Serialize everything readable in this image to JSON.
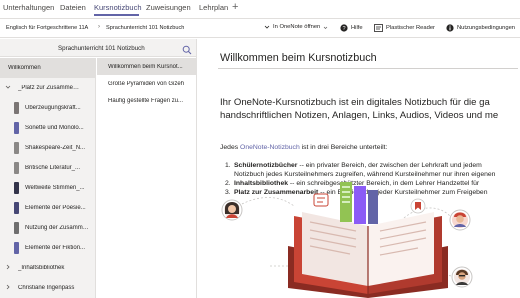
{
  "tabs": {
    "items": [
      "Unterhaltungen",
      "Dateien",
      "Kursnotizbuch",
      "Zuweisungen",
      "Lehrplan"
    ],
    "active_index": 2,
    "plus": "+"
  },
  "breadcrumb": {
    "items": [
      "Englisch für Fortgeschrittene 11A",
      "Sprachunterricht 101 Notizbuch"
    ],
    "separator": "›"
  },
  "toolbar": {
    "open_in": "In OneNote öffnen",
    "help": "Hilfe",
    "reader": "Plastischer Reader",
    "terms": "Nutzungsbedingungen"
  },
  "notebook": {
    "title": "Sprachunterricht 101 Notizbuch"
  },
  "sections": [
    {
      "label": "Willkommen",
      "type": "section",
      "color": "",
      "selected": true
    },
    {
      "label": "_Platz zur Zusammena...",
      "type": "group",
      "expanded": true
    },
    {
      "label": "Überzeugungskraft...",
      "type": "section",
      "color": "#7a7574"
    },
    {
      "label": "Sonette und Monolo...",
      "type": "section",
      "color": "#6264a7"
    },
    {
      "label": "Shakespeare-Zeit_N...",
      "type": "section",
      "color": "#8a8886"
    },
    {
      "label": "Britische Literatur_...",
      "type": "section",
      "color": "#8a8886"
    },
    {
      "label": "Weltweite Stimmen_...",
      "type": "section",
      "color": "#33344a"
    },
    {
      "label": "Elemente der Poesie...",
      "type": "section",
      "color": "#464775"
    },
    {
      "label": "Nutzung der Zusamme...",
      "type": "section",
      "color": "#6e6e6e"
    },
    {
      "label": "Elemente der Fiktion...",
      "type": "section",
      "color": "#6264a7"
    },
    {
      "label": "_Inhaltsbibliothek",
      "type": "group",
      "expanded": false
    },
    {
      "label": "Christiane Ingenpass",
      "type": "group",
      "expanded": false
    }
  ],
  "pages": [
    {
      "label": "Willkommen beim Kursnot...",
      "selected": true
    },
    {
      "label": "Große Pyramiden von Gizeh",
      "selected": false
    },
    {
      "label": "Häufig gestellte Fragen zu...",
      "selected": false
    }
  ],
  "content": {
    "title": "Willkommen beim Kursnotizbuch",
    "intro_lines": [
      "Ihr OneNote-Kursnotizbuch ist ein digitales Notizbuch für die ga",
      "handschriftlichen Notizen, Anlagen, Links, Audios, Videos und me"
    ],
    "areas_prefix": "Jedes ",
    "areas_link": "OneNote-Notizbuch",
    "areas_suffix": " ist in drei Bereiche unterteilt:",
    "list": [
      {
        "num": "1.",
        "bold": "Schülernotizbücher",
        "text": " -- ein privater Bereich, der zwischen der Lehrkraft und jedem",
        "continuation": "Notizbuch jedes Kursteilnehmers zugreifen, während Kursteilnehmer nur ihren eigenen"
      },
      {
        "num": "2.",
        "bold": "Inhaltsbibliothek",
        "text": " -- ein schreibgeschützter Bereich, in dem Lehrer Handzettel für"
      },
      {
        "num": "3.",
        "bold": "Platz zur Zusammenarbeit",
        "text": " -- ein Bereich, den jeder Kursteilnehmer zum Freigeben"
      }
    ]
  },
  "colors": {
    "accent": "#6264a7",
    "book_red": "#c94435",
    "book_dark": "#8a2b22",
    "page_light": "#f2e6e2",
    "green_tab": "#92c353",
    "purple_tab": "#8b5cf6"
  }
}
